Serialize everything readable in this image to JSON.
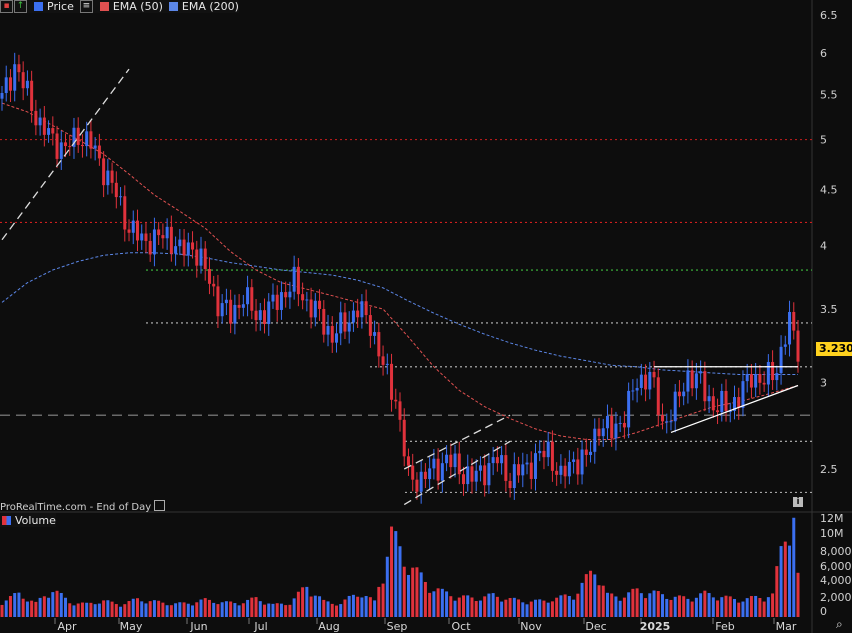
{
  "legend": {
    "price_label": "Price",
    "ema50_label": "EMA (50)",
    "ema200_label": "EMA (200)",
    "volume_label": "Volume",
    "price_color": "#3b6ff0",
    "ema50_color": "#e05050",
    "ema200_color": "#5b86e6"
  },
  "watermark": "ProRealTime.com - End of Day",
  "last_price_label": "3.230",
  "colors": {
    "up": "#3b6ff0",
    "down": "#e0323c",
    "bg": "#0d0d0d",
    "grid_red": "#cc1f1f",
    "grid_green": "#3fbf3f"
  },
  "chart_data": {
    "type": "candlestick",
    "price_axis": {
      "ticks": [
        2.5,
        3,
        3.5,
        4,
        4.5,
        5,
        5.5,
        6,
        6.5
      ],
      "labels": [
        "2.5",
        "3",
        "3.5",
        "4",
        "4.5",
        "5",
        "5.5",
        "6",
        "6.5"
      ],
      "scale": "log"
    },
    "volume_axis": {
      "labels": [
        "12M",
        "10M",
        "8,000K",
        "6,000K",
        "4,000K",
        "2,000K",
        "0"
      ],
      "ticks": [
        12000000,
        10000000,
        8000000,
        6000000,
        4000000,
        2000000,
        0
      ]
    },
    "time_labels": [
      "Apr",
      "May",
      "Jun",
      "Jul",
      "Aug",
      "Sep",
      "Oct",
      "Nov",
      "Dec",
      "2025",
      "Feb",
      "Mar"
    ],
    "horizontal_levels": [
      {
        "price": 5.0,
        "color": "#cc1f1f",
        "style": "dotted"
      },
      {
        "price": 4.2,
        "color": "#cc1f1f",
        "style": "dotted"
      },
      {
        "price": 3.8,
        "color": "#3fbf3f",
        "style": "dotted"
      },
      {
        "price": 3.4,
        "color": "#bbbbbb",
        "style": "dotted"
      },
      {
        "price": 3.1,
        "color": "#bbbbbb",
        "style": "dotted"
      },
      {
        "price": 2.8,
        "color": "#888888",
        "style": "dashed"
      },
      {
        "price": 2.65,
        "color": "#bbbbbb",
        "style": "dotted"
      },
      {
        "price": 2.38,
        "color": "#bbbbbb",
        "style": "dotted"
      }
    ],
    "close_series": [
      {
        "t": 0,
        "c": 5.45
      },
      {
        "t": 3,
        "c": 5.85
      },
      {
        "t": 6,
        "c": 5.5
      },
      {
        "t": 9,
        "c": 5.15
      },
      {
        "t": 12,
        "c": 5.0
      },
      {
        "t": 15,
        "c": 4.9
      },
      {
        "t": 18,
        "c": 5.05
      },
      {
        "t": 21,
        "c": 4.95
      },
      {
        "t": 24,
        "c": 4.7
      },
      {
        "t": 27,
        "c": 4.45
      },
      {
        "t": 30,
        "c": 4.15
      },
      {
        "t": 33,
        "c": 4.05
      },
      {
        "t": 36,
        "c": 4.05
      },
      {
        "t": 39,
        "c": 4.1
      },
      {
        "t": 42,
        "c": 3.95
      },
      {
        "t": 45,
        "c": 4.0
      },
      {
        "t": 48,
        "c": 3.8
      },
      {
        "t": 51,
        "c": 3.55
      },
      {
        "t": 54,
        "c": 3.45
      },
      {
        "t": 57,
        "c": 3.6
      },
      {
        "t": 60,
        "c": 3.45
      },
      {
        "t": 63,
        "c": 3.5
      },
      {
        "t": 66,
        "c": 3.6
      },
      {
        "t": 69,
        "c": 3.7
      },
      {
        "t": 72,
        "c": 3.55
      },
      {
        "t": 75,
        "c": 3.45
      },
      {
        "t": 78,
        "c": 3.3
      },
      {
        "t": 81,
        "c": 3.4
      },
      {
        "t": 84,
        "c": 3.5
      },
      {
        "t": 87,
        "c": 3.4
      },
      {
        "t": 90,
        "c": 3.1
      },
      {
        "t": 93,
        "c": 2.9
      },
      {
        "t": 96,
        "c": 2.45
      },
      {
        "t": 99,
        "c": 2.45
      },
      {
        "t": 102,
        "c": 2.5
      },
      {
        "t": 105,
        "c": 2.55
      },
      {
        "t": 108,
        "c": 2.5
      },
      {
        "t": 111,
        "c": 2.45
      },
      {
        "t": 114,
        "c": 2.5
      },
      {
        "t": 117,
        "c": 2.55
      },
      {
        "t": 120,
        "c": 2.45
      },
      {
        "t": 123,
        "c": 2.5
      },
      {
        "t": 126,
        "c": 2.55
      },
      {
        "t": 129,
        "c": 2.6
      },
      {
        "t": 132,
        "c": 2.45
      },
      {
        "t": 135,
        "c": 2.55
      },
      {
        "t": 138,
        "c": 2.55
      },
      {
        "t": 141,
        "c": 2.75
      },
      {
        "t": 144,
        "c": 2.7
      },
      {
        "t": 147,
        "c": 2.8
      },
      {
        "t": 150,
        "c": 3.0
      },
      {
        "t": 153,
        "c": 3.05
      },
      {
        "t": 156,
        "c": 2.75
      },
      {
        "t": 159,
        "c": 2.85
      },
      {
        "t": 162,
        "c": 3.05
      },
      {
        "t": 165,
        "c": 3.0
      },
      {
        "t": 168,
        "c": 2.85
      },
      {
        "t": 171,
        "c": 2.85
      },
      {
        "t": 174,
        "c": 2.9
      },
      {
        "t": 177,
        "c": 3.05
      },
      {
        "t": 180,
        "c": 3.0
      },
      {
        "t": 183,
        "c": 3.1
      },
      {
        "t": 186,
        "c": 3.4
      },
      {
        "t": 188,
        "c": 3.23
      }
    ],
    "ema50_series": [
      {
        "t": 0,
        "v": 5.4
      },
      {
        "t": 6,
        "v": 5.3
      },
      {
        "t": 12,
        "v": 5.15
      },
      {
        "t": 18,
        "v": 5.0
      },
      {
        "t": 24,
        "v": 4.85
      },
      {
        "t": 30,
        "v": 4.65
      },
      {
        "t": 36,
        "v": 4.45
      },
      {
        "t": 42,
        "v": 4.3
      },
      {
        "t": 48,
        "v": 4.15
      },
      {
        "t": 54,
        "v": 3.95
      },
      {
        "t": 60,
        "v": 3.8
      },
      {
        "t": 66,
        "v": 3.7
      },
      {
        "t": 72,
        "v": 3.65
      },
      {
        "t": 78,
        "v": 3.6
      },
      {
        "t": 84,
        "v": 3.55
      },
      {
        "t": 90,
        "v": 3.5
      },
      {
        "t": 96,
        "v": 3.3
      },
      {
        "t": 102,
        "v": 3.1
      },
      {
        "t": 108,
        "v": 2.95
      },
      {
        "t": 114,
        "v": 2.85
      },
      {
        "t": 120,
        "v": 2.78
      },
      {
        "t": 126,
        "v": 2.72
      },
      {
        "t": 132,
        "v": 2.68
      },
      {
        "t": 138,
        "v": 2.66
      },
      {
        "t": 144,
        "v": 2.66
      },
      {
        "t": 150,
        "v": 2.7
      },
      {
        "t": 156,
        "v": 2.75
      },
      {
        "t": 162,
        "v": 2.8
      },
      {
        "t": 168,
        "v": 2.85
      },
      {
        "t": 174,
        "v": 2.88
      },
      {
        "t": 180,
        "v": 2.92
      },
      {
        "t": 188,
        "v": 2.98
      }
    ],
    "ema200_series": [
      {
        "t": 0,
        "v": 3.55
      },
      {
        "t": 6,
        "v": 3.7
      },
      {
        "t": 12,
        "v": 3.8
      },
      {
        "t": 18,
        "v": 3.87
      },
      {
        "t": 24,
        "v": 3.92
      },
      {
        "t": 30,
        "v": 3.94
      },
      {
        "t": 36,
        "v": 3.94
      },
      {
        "t": 42,
        "v": 3.93
      },
      {
        "t": 48,
        "v": 3.9
      },
      {
        "t": 54,
        "v": 3.86
      },
      {
        "t": 60,
        "v": 3.83
      },
      {
        "t": 66,
        "v": 3.8
      },
      {
        "t": 72,
        "v": 3.78
      },
      {
        "t": 78,
        "v": 3.76
      },
      {
        "t": 84,
        "v": 3.72
      },
      {
        "t": 90,
        "v": 3.66
      },
      {
        "t": 96,
        "v": 3.56
      },
      {
        "t": 102,
        "v": 3.47
      },
      {
        "t": 108,
        "v": 3.39
      },
      {
        "t": 114,
        "v": 3.32
      },
      {
        "t": 120,
        "v": 3.26
      },
      {
        "t": 126,
        "v": 3.21
      },
      {
        "t": 132,
        "v": 3.17
      },
      {
        "t": 138,
        "v": 3.14
      },
      {
        "t": 144,
        "v": 3.11
      },
      {
        "t": 150,
        "v": 3.1
      },
      {
        "t": 156,
        "v": 3.08
      },
      {
        "t": 162,
        "v": 3.07
      },
      {
        "t": 168,
        "v": 3.06
      },
      {
        "t": 174,
        "v": 3.05
      },
      {
        "t": 180,
        "v": 3.05
      },
      {
        "t": 188,
        "v": 3.05
      }
    ],
    "volume_series": [
      {
        "t": 0,
        "v": 1.2
      },
      {
        "t": 4,
        "v": 2.2
      },
      {
        "t": 8,
        "v": 1.0
      },
      {
        "t": 12,
        "v": 2.8
      },
      {
        "t": 16,
        "v": 1.1
      },
      {
        "t": 20,
        "v": 0.9
      },
      {
        "t": 24,
        "v": 1.3
      },
      {
        "t": 28,
        "v": 0.8
      },
      {
        "t": 32,
        "v": 1.5
      },
      {
        "t": 36,
        "v": 1.2
      },
      {
        "t": 40,
        "v": 0.9
      },
      {
        "t": 44,
        "v": 1.0
      },
      {
        "t": 48,
        "v": 1.4
      },
      {
        "t": 52,
        "v": 1.1
      },
      {
        "t": 56,
        "v": 1.0
      },
      {
        "t": 60,
        "v": 1.6
      },
      {
        "t": 64,
        "v": 0.8
      },
      {
        "t": 68,
        "v": 1.0
      },
      {
        "t": 72,
        "v": 3.2
      },
      {
        "t": 76,
        "v": 1.2
      },
      {
        "t": 80,
        "v": 0.9
      },
      {
        "t": 84,
        "v": 2.4
      },
      {
        "t": 88,
        "v": 1.2
      },
      {
        "t": 92,
        "v": 9.6
      },
      {
        "t": 95,
        "v": 6.8
      },
      {
        "t": 98,
        "v": 4.8
      },
      {
        "t": 101,
        "v": 3.2
      },
      {
        "t": 104,
        "v": 2.4
      },
      {
        "t": 108,
        "v": 1.8
      },
      {
        "t": 112,
        "v": 1.6
      },
      {
        "t": 116,
        "v": 2.0
      },
      {
        "t": 120,
        "v": 1.5
      },
      {
        "t": 124,
        "v": 1.2
      },
      {
        "t": 128,
        "v": 1.3
      },
      {
        "t": 132,
        "v": 1.7
      },
      {
        "t": 136,
        "v": 2.4
      },
      {
        "t": 140,
        "v": 5.6
      },
      {
        "t": 143,
        "v": 2.0
      },
      {
        "t": 146,
        "v": 1.8
      },
      {
        "t": 150,
        "v": 2.6
      },
      {
        "t": 154,
        "v": 2.3
      },
      {
        "t": 158,
        "v": 1.8
      },
      {
        "t": 162,
        "v": 1.6
      },
      {
        "t": 166,
        "v": 2.2
      },
      {
        "t": 170,
        "v": 1.8
      },
      {
        "t": 174,
        "v": 1.4
      },
      {
        "t": 178,
        "v": 1.7
      },
      {
        "t": 182,
        "v": 2.0
      },
      {
        "t": 185,
        "v": 10.6
      },
      {
        "t": 187,
        "v": 11.8
      },
      {
        "t": 188,
        "v": 4.2
      }
    ],
    "trendlines": [
      {
        "points": [
          [
            0,
            4.05
          ],
          [
            30,
            5.8
          ]
        ],
        "color": "#dddddd",
        "style": "dashed"
      },
      {
        "points": [
          [
            95,
            2.32
          ],
          [
            120,
            2.65
          ]
        ],
        "color": "#dddddd",
        "style": "dashed"
      },
      {
        "points": [
          [
            95,
            2.5
          ],
          [
            120,
            2.8
          ]
        ],
        "color": "#dddddd",
        "style": "dashed"
      },
      {
        "points": [
          [
            158,
            2.7
          ],
          [
            188,
            2.98
          ]
        ],
        "color": "#ffffff",
        "style": "solid"
      },
      {
        "points": [
          [
            154,
            3.1
          ],
          [
            188,
            3.1
          ]
        ],
        "color": "#ffffff",
        "style": "solid"
      }
    ]
  }
}
